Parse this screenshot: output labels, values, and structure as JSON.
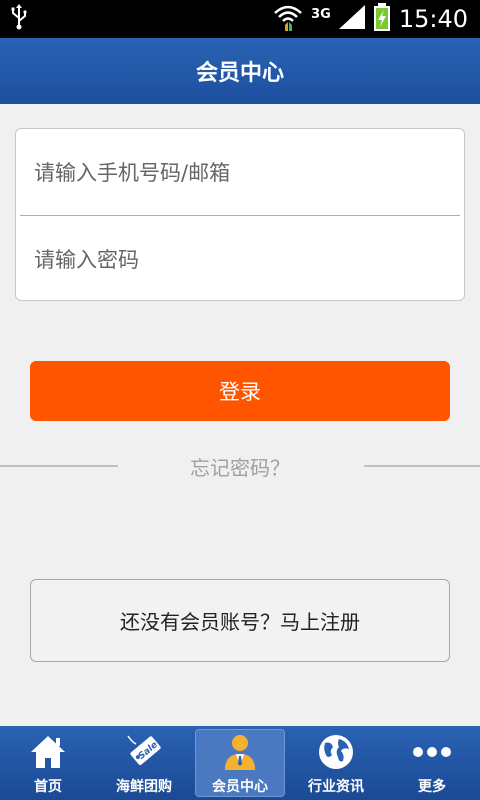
{
  "status_bar": {
    "network": "3G",
    "time": "15:40"
  },
  "header": {
    "title": "会员中心"
  },
  "login_form": {
    "account_placeholder": "请输入手机号码/邮箱",
    "password_placeholder": "请输入密码",
    "login_label": "登录",
    "forgot_label": "忘记密码？",
    "register_label": "还没有会员账号？马上注册"
  },
  "colors": {
    "header_blue": "#1d4f9e",
    "login_orange": "#ff5400"
  },
  "tabbar": {
    "tabs": [
      {
        "label": "首页",
        "icon": "home-icon"
      },
      {
        "label": "海鲜团购",
        "icon": "sale-tag-icon"
      },
      {
        "label": "会员中心",
        "icon": "member-icon",
        "active": true
      },
      {
        "label": "行业资讯",
        "icon": "globe-icon"
      },
      {
        "label": "更多",
        "icon": "more-icon"
      }
    ]
  }
}
